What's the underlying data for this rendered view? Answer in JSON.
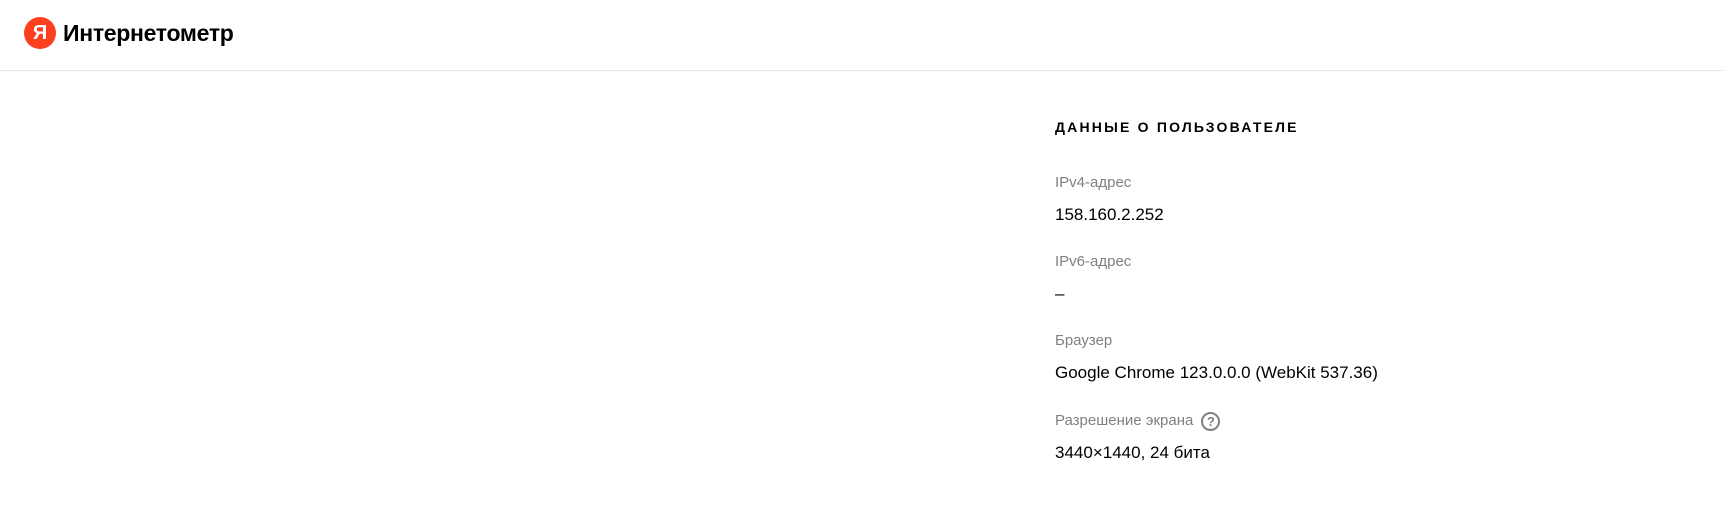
{
  "header": {
    "logo_letter": "Я",
    "app_name": "Интернетометр"
  },
  "user_data": {
    "title": "ДАННЫЕ О ПОЛЬЗОВАТЕЛЕ",
    "fields": [
      {
        "label": "IPv4-адрес",
        "value": "158.160.2.252"
      },
      {
        "label": "IPv6-адрес",
        "value": "–"
      },
      {
        "label": "Браузер",
        "value": "Google Chrome 123.0.0.0 (WebKit 537.36)"
      },
      {
        "label": "Разрешение экрана",
        "value": "3440×1440, 24 бита",
        "help_icon": "question-icon",
        "help_symbol": "?"
      }
    ]
  },
  "colors": {
    "brand_red": "#fc3f1d",
    "label_gray": "#808080",
    "divider": "#e5e5e5"
  }
}
